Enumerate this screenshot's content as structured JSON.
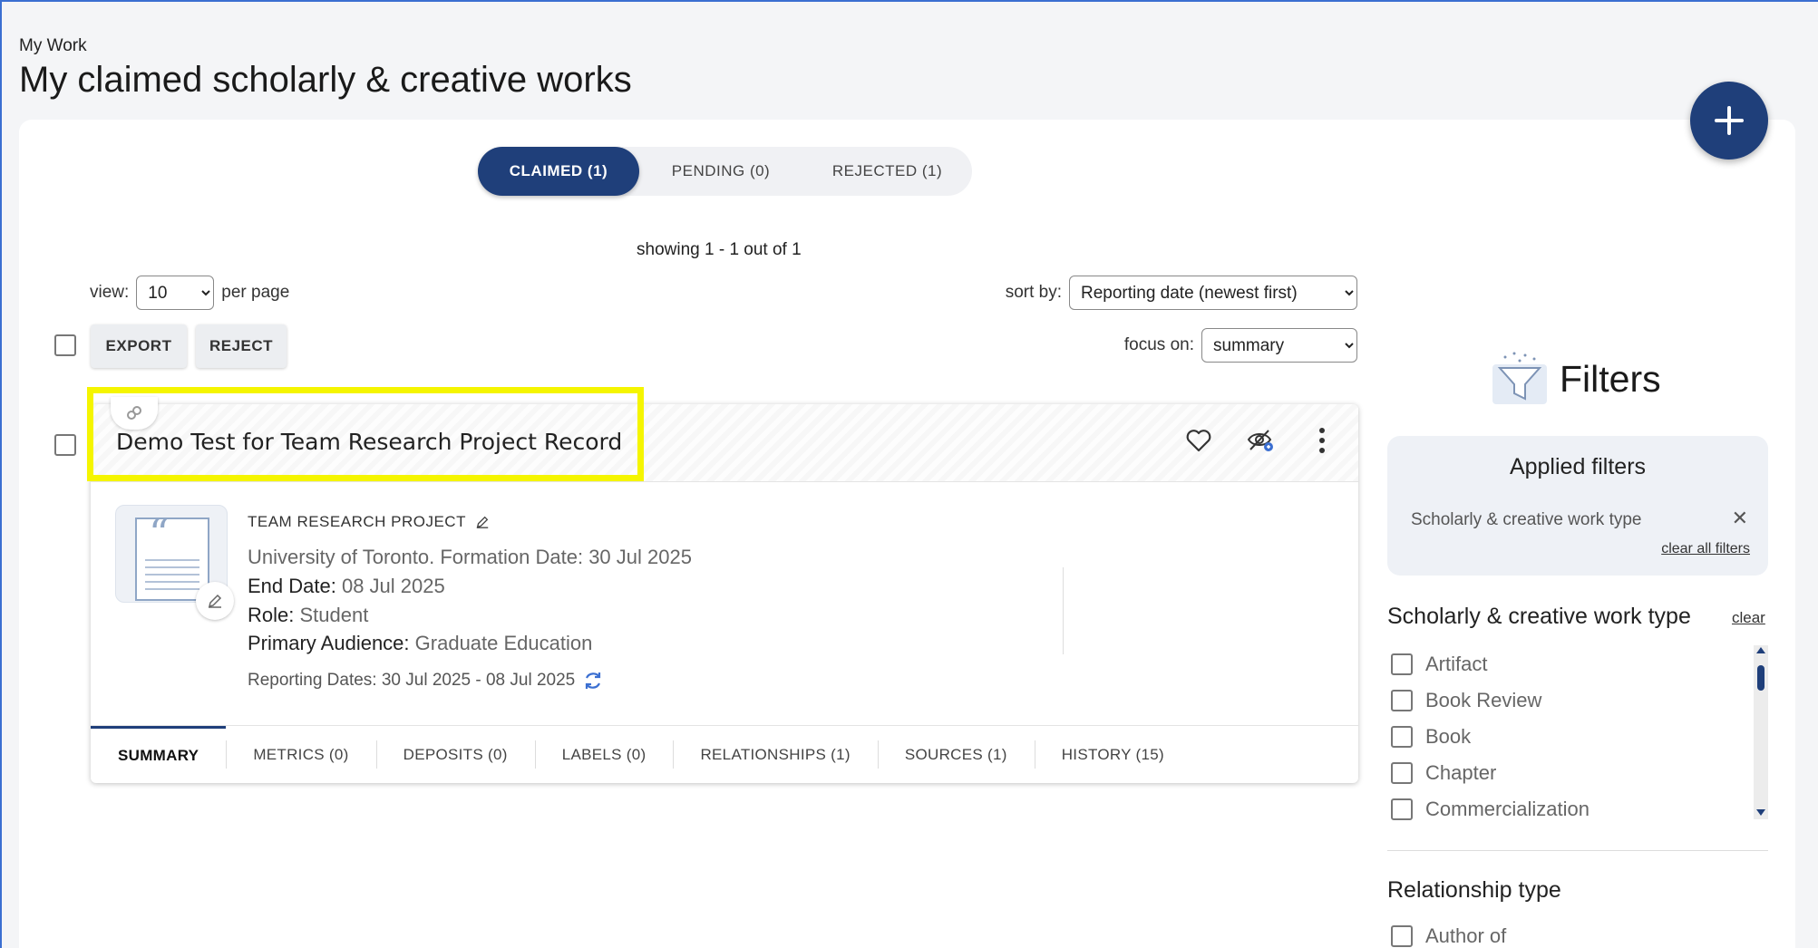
{
  "header": {
    "breadcrumb": "My Work",
    "title": "My claimed scholarly & creative works"
  },
  "fab": {
    "icon": "plus-icon"
  },
  "status_tabs": [
    {
      "label": "CLAIMED (1)",
      "active": true
    },
    {
      "label": "PENDING (0)",
      "active": false
    },
    {
      "label": "REJECTED (1)",
      "active": false
    }
  ],
  "list": {
    "showing": "showing 1 - 1 out of 1",
    "view_label": "view:",
    "per_page_value": "10",
    "per_page_label": "per page",
    "sort_label": "sort by:",
    "sort_value": "Reporting date (newest first)",
    "focus_label": "focus on:",
    "focus_value": "summary",
    "export_label": "EXPORT",
    "reject_label": "REJECT"
  },
  "record": {
    "title": "Demo Test for Team Research Project Record",
    "type": "TEAM RESEARCH PROJECT",
    "line1": "University of Toronto. Formation Date: 30 Jul 2025",
    "end_date_label": "End Date:",
    "end_date_value": "08 Jul 2025",
    "role_label": "Role:",
    "role_value": "Student",
    "audience_label": "Primary Audience:",
    "audience_value": "Graduate Education",
    "reporting_dates": "Reporting Dates: 30 Jul 2025 - 08 Jul 2025",
    "tabs": [
      {
        "label": "SUMMARY",
        "active": true
      },
      {
        "label": "METRICS (0)"
      },
      {
        "label": "DEPOSITS (0)"
      },
      {
        "label": "LABELS (0)"
      },
      {
        "label": "RELATIONSHIPS (1)"
      },
      {
        "label": "SOURCES (1)"
      },
      {
        "label": "HISTORY (15)"
      }
    ]
  },
  "filters": {
    "title": "Filters",
    "applied_title": "Applied filters",
    "applied_chip": "Scholarly & creative work type",
    "clear_all": "clear all filters",
    "group1_title": "Scholarly & creative work type",
    "group1_clear": "clear",
    "group1_options": [
      "Artifact",
      "Book Review",
      "Book",
      "Chapter",
      "Commercialization"
    ],
    "group2_title": "Relationship type",
    "group2_options": [
      "Author of"
    ]
  },
  "colors": {
    "brand_navy": "#1f3f7a",
    "highlight_yellow": "#f5f500",
    "panel_bg": "#eef1f6"
  }
}
